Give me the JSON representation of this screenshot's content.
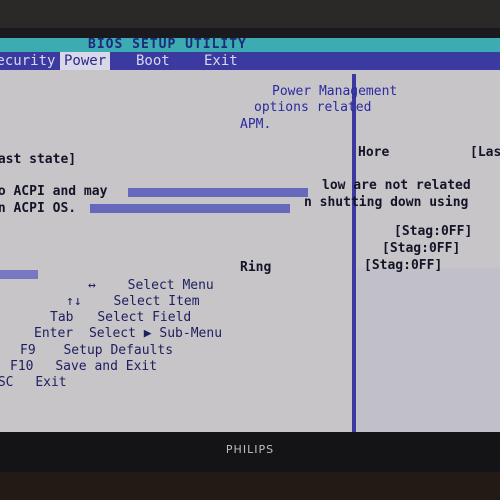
{
  "title": "BIOS SETUP UTILITY",
  "menu": {
    "items": [
      {
        "label": "Security",
        "display": "Security",
        "active": false
      },
      {
        "label": "Power",
        "display": "Power",
        "active": true
      },
      {
        "label": "Boot",
        "display": "Boot",
        "active": false
      },
      {
        "label": "Exit",
        "display": "Exit",
        "active": false
      }
    ]
  },
  "help": {
    "line1": "Power Management",
    "line2": "options related",
    "line3": "APM."
  },
  "items": {
    "heading_fragment": "Hore",
    "last_state_label": "Last state]",
    "last_state_value": "[Last state]",
    "desc_left_1": "to ACPI and may",
    "desc_right_1": "low are not related",
    "desc_left_2": "on ACPI OS.",
    "desc_right_2": "n shutting down using",
    "stag1": "[Stag:0FF]",
    "stag2": "[Stag:0FF]",
    "stag3": "[Stag:0FF]",
    "ring": "Ring"
  },
  "keys": [
    {
      "key": "↔",
      "action": "Select Menu"
    },
    {
      "key": "↑↓",
      "action": "Select Item"
    },
    {
      "key": "Tab",
      "action": "Select Field"
    },
    {
      "key": "Enter",
      "action": "Select ▶ Sub-Menu"
    },
    {
      "key": "F9",
      "action": "Setup Defaults"
    },
    {
      "key": "F10",
      "action": "Save and Exit"
    },
    {
      "key": "ESC",
      "action": "Exit"
    }
  ],
  "monitor": {
    "brand": "PHILIPS"
  },
  "colors": {
    "title_bar": "#3cabb2",
    "menu_bar": "#3a3aa0",
    "screen_bg": "#c7c5c7",
    "text_blue": "#2a2aa0"
  }
}
